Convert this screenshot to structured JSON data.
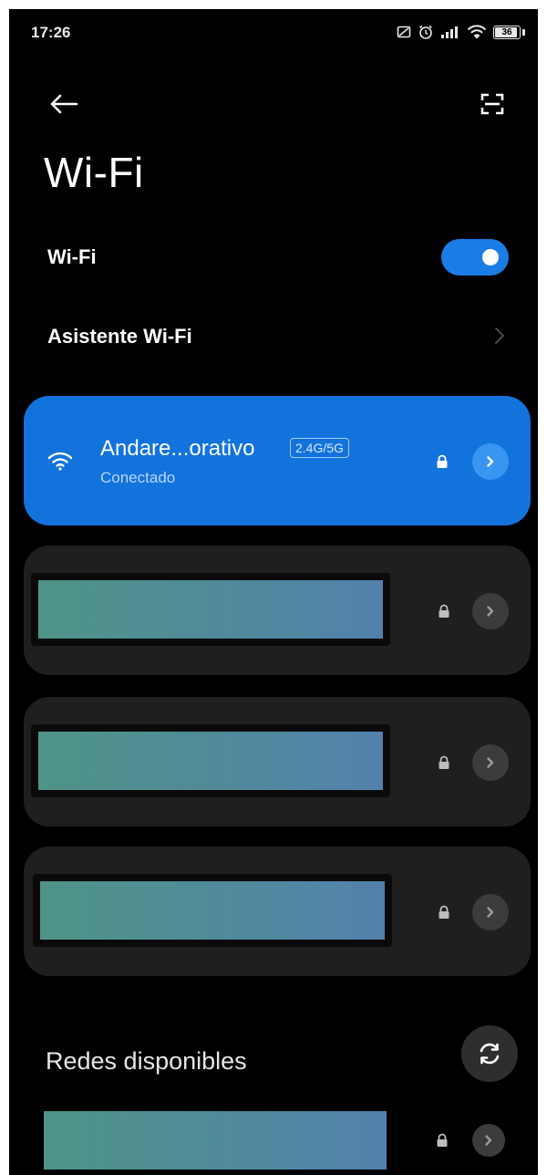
{
  "status_bar": {
    "time": "17:26",
    "battery": "36",
    "battery_percent": 36,
    "icons": [
      "screenshot-icon",
      "alarm-icon",
      "signal-icon",
      "wifi-status-icon",
      "battery-icon"
    ]
  },
  "header": {
    "back_icon": "arrow-left-icon",
    "scan_icon": "qr-scan-icon",
    "title": "Wi-Fi"
  },
  "wifi_toggle": {
    "label": "Wi-Fi",
    "enabled": true
  },
  "assistant": {
    "label": "Asistente Wi-Fi"
  },
  "connected_network": {
    "name": "Andare...orativo",
    "band": "2.4G/5G",
    "status": "Conectado",
    "secured": true
  },
  "saved_networks_count": 3,
  "available_section": {
    "title": "Redes disponibles"
  },
  "colors": {
    "accent": "#1373dd",
    "toggle_on": "#1a7de6",
    "card_bg": "#1f1f1f",
    "background": "#000000"
  }
}
